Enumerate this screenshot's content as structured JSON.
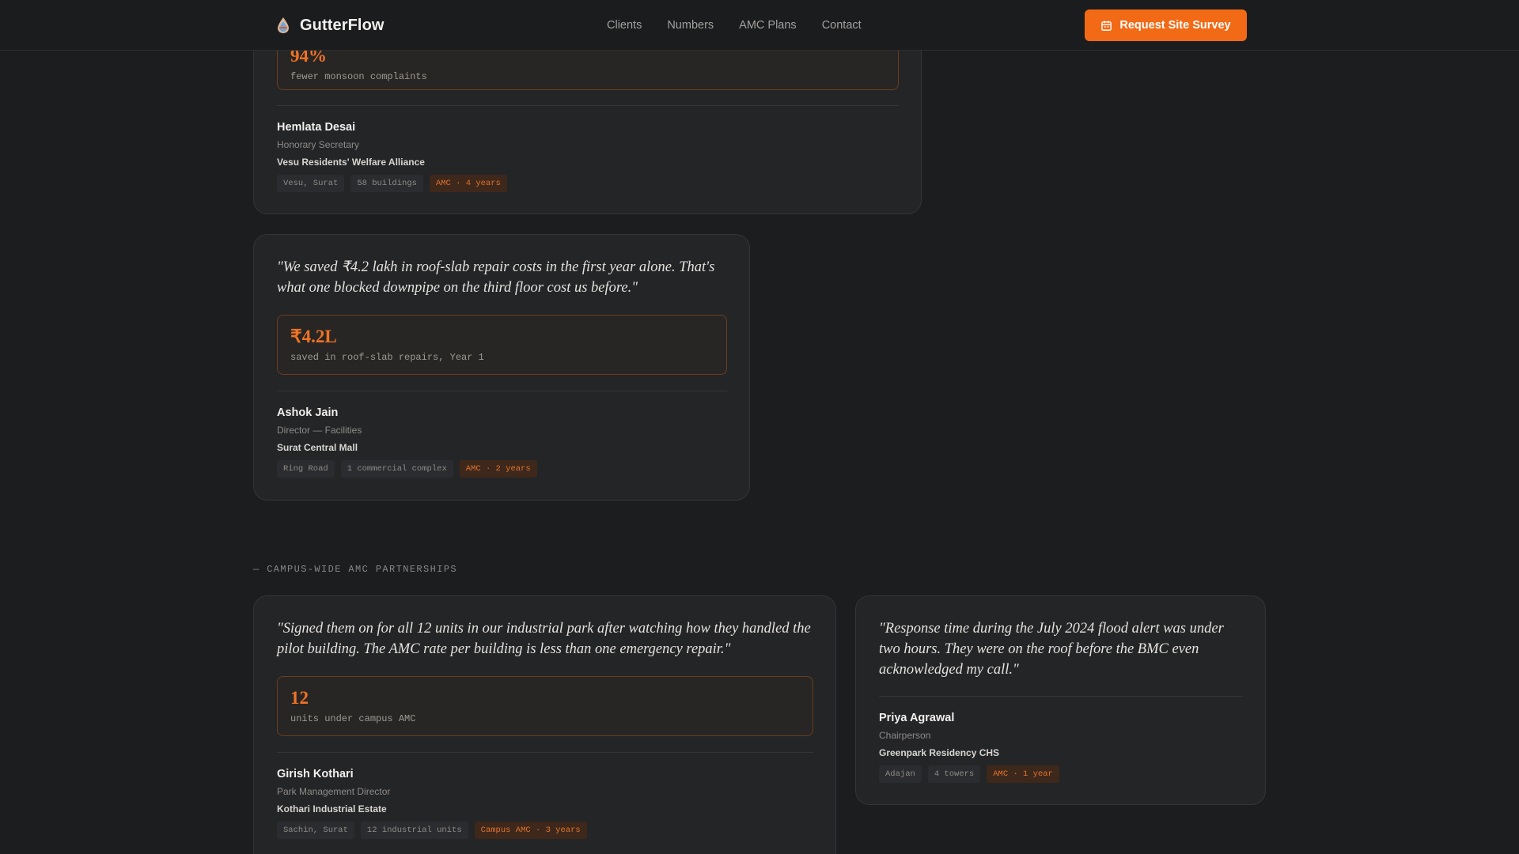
{
  "header": {
    "brand": "GutterFlow",
    "nav": [
      "Clients",
      "Numbers",
      "AMC Plans",
      "Contact"
    ],
    "cta_label": "Request Site Survey"
  },
  "card1": {
    "metric_value": "94%",
    "metric_label": "fewer monsoon complaints",
    "author": "Hemlata Desai",
    "role": "Honorary Secretary",
    "org": "Vesu Residents' Welfare Alliance",
    "tags": [
      "Vesu, Surat",
      "58 buildings",
      "AMC · 4 years"
    ]
  },
  "card2": {
    "quote": "\"We saved ₹4.2 lakh in roof-slab repair costs in the first year alone. That's what one blocked downpipe on the third floor cost us before.\"",
    "metric_value": "₹4.2L",
    "metric_label": "saved in roof-slab repairs, Year 1",
    "author": "Ashok Jain",
    "role": "Director — Facilities",
    "org": "Surat Central Mall",
    "tags": [
      "Ring Road",
      "1 commercial complex",
      "AMC · 2 years"
    ]
  },
  "section_label": "— CAMPUS-WIDE AMC PARTNERSHIPS",
  "card3": {
    "quote": "\"Signed them on for all 12 units in our industrial park after watching how they handled the pilot building. The AMC rate per building is less than one emergency repair.\"",
    "metric_value": "12",
    "metric_label": "units under campus AMC",
    "author": "Girish Kothari",
    "role": "Park Management Director",
    "org": "Kothari Industrial Estate",
    "tags": [
      "Sachin, Surat",
      "12 industrial units",
      "Campus AMC · 3 years"
    ]
  },
  "card4": {
    "quote": "\"Response time during the July 2024 flood alert was under two hours. They were on the roof before the BMC even acknowledged my call.\"",
    "author": "Priya Agrawal",
    "role": "Chairperson",
    "org": "Greenpark Residency CHS",
    "tags": [
      "Adajan",
      "4 towers",
      "AMC · 1 year"
    ]
  },
  "colors": {
    "accent": "#f26a16",
    "background": "#1c1d1f",
    "card": "#242527",
    "metric_text": "#f07225"
  },
  "icons": {
    "brand": "droplet-icon",
    "cta": "calendar-icon"
  }
}
